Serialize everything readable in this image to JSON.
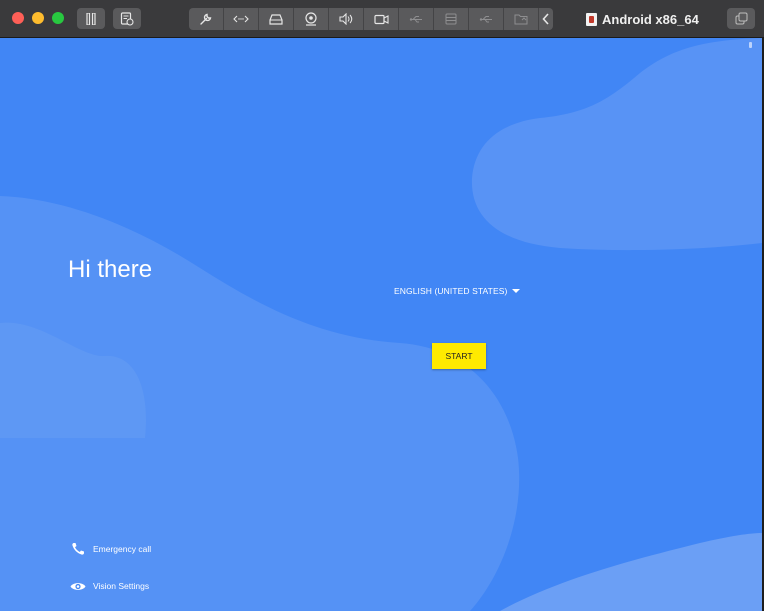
{
  "window": {
    "title": "Android x86_64",
    "toolbar_icons": [
      "wrench-icon",
      "network-arrows-icon",
      "drive-icon",
      "webcam-icon",
      "speaker-icon",
      "camera-icon",
      "usb-icon",
      "hdd-icon",
      "usb-alt-icon",
      "shared-folder-icon",
      "chevron-left-icon"
    ]
  },
  "setup": {
    "greeting": "Hi there",
    "language": "ENGLISH (UNITED STATES)",
    "start_label": "START"
  },
  "accessibility": {
    "emergency_label": "Emergency call",
    "vision_label": "Vision Settings"
  },
  "colors": {
    "background": "#4186f5",
    "start_button": "#ffea00"
  }
}
